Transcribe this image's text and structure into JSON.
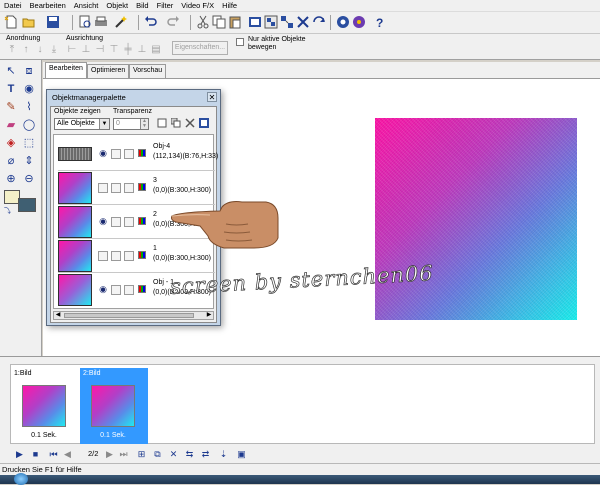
{
  "menu": [
    "Datei",
    "Bearbeiten",
    "Ansicht",
    "Objekt",
    "Bild",
    "Filter",
    "Video F/X",
    "Hilfe"
  ],
  "toolbar2": {
    "group_anordnung": "Anordnung",
    "group_ausrichtung": "Ausrichtung",
    "properties_button": "Eigenschaften...",
    "checkbox_label_1": "Nur aktive Objekte",
    "checkbox_label_2": "bewegen"
  },
  "tabs": [
    {
      "label": "Bearbeiten",
      "active": true
    },
    {
      "label": "Optimieren",
      "active": false
    },
    {
      "label": "Vorschau",
      "active": false
    }
  ],
  "object_palette": {
    "title": "Objektmanagerpalette",
    "show_label": "Objekte zeigen",
    "show_value": "Alle Objekte",
    "transparency_label": "Transparenz",
    "transparency_value": "0",
    "objects": [
      {
        "name": "Obj-4",
        "info": "(112,134)(B:76,H:33)",
        "kind": "gray",
        "visible": true
      },
      {
        "name": "3",
        "info": "(0,0)(B:300,H:300)",
        "kind": "gradient",
        "visible": false
      },
      {
        "name": "2",
        "info": "(0,0)(B:300,H:300)",
        "kind": "gradient",
        "visible": true
      },
      {
        "name": "1",
        "info": "(0,0)(B:300,H:300)",
        "kind": "gradient",
        "visible": false
      },
      {
        "name": "Obj - 1",
        "info": "(0,0)(B:300,H:300)",
        "kind": "gradient",
        "visible": true
      }
    ]
  },
  "watermark": "screen by sternchen06",
  "frames": [
    {
      "label": "1:Bild",
      "delay": "0.1 Sek.",
      "selected": false
    },
    {
      "label": "2:Bild",
      "delay": "0.1 Sek.",
      "selected": true
    }
  ],
  "playbar": {
    "page": "2/2"
  },
  "status": "Drucken Sie F1 für Hilfe",
  "colors": {
    "gradient_start": "#ff16a8",
    "gradient_end": "#19f2f0",
    "selection": "#3399ff",
    "foreground_swatch": "#f4f0c8",
    "background_swatch": "#3f5f72"
  },
  "icons": [
    "new-icon",
    "open-icon",
    "save-icon",
    "undo-icon",
    "redo-icon",
    "cut-icon",
    "copy-icon",
    "paste-icon",
    "help-icon",
    "pointer-icon",
    "text-icon",
    "brush-icon",
    "eraser-icon",
    "fill-icon",
    "eyedropper-icon",
    "zoom-in-icon",
    "zoom-out-icon",
    "play-icon",
    "first-frame-icon",
    "last-frame-icon"
  ]
}
